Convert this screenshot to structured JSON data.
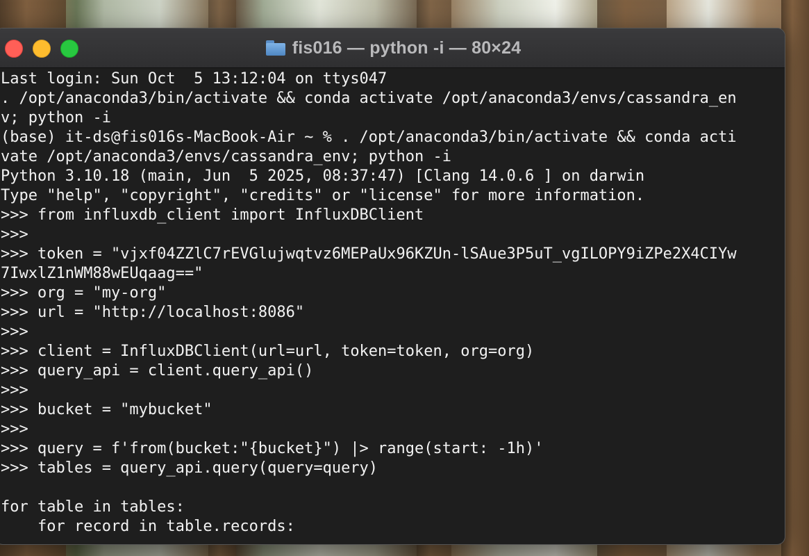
{
  "window": {
    "title": "fis016 — python -i — 80×24",
    "icon": "folder-icon"
  },
  "terminal": {
    "lines": [
      "Last login: Sun Oct  5 13:12:04 on ttys047",
      ". /opt/anaconda3/bin/activate && conda activate /opt/anaconda3/envs/cassandra_en",
      "v; python -i",
      "(base) it-ds@fis016s-MacBook-Air ~ % . /opt/anaconda3/bin/activate && conda acti",
      "vate /opt/anaconda3/envs/cassandra_env; python -i",
      "Python 3.10.18 (main, Jun  5 2025, 08:37:47) [Clang 14.0.6 ] on darwin",
      "Type \"help\", \"copyright\", \"credits\" or \"license\" for more information.",
      ">>> from influxdb_client import InfluxDBClient",
      ">>>",
      ">>> token = \"vjxf04ZZlC7rEVGlujwqtvz6MEPaUx96KZUn-lSAue3P5uT_vgILOPY9iZPe2X4CIYw",
      "7IwxlZ1nWM88wEUqaag==\"",
      ">>> org = \"my-org\"",
      ">>> url = \"http://localhost:8086\"",
      ">>>",
      ">>> client = InfluxDBClient(url=url, token=token, org=org)",
      ">>> query_api = client.query_api()",
      ">>>",
      ">>> bucket = \"mybucket\"",
      ">>>",
      ">>> query = f'from(bucket:\"{bucket}\") |> range(start: -1h)'",
      ">>> tables = query_api.query(query=query)",
      "",
      "for table in tables:",
      "    for record in table.records:"
    ]
  }
}
